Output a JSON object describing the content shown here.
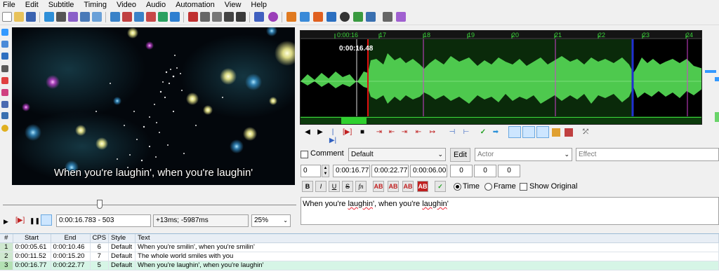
{
  "menu": [
    "File",
    "Edit",
    "Subtitle",
    "Timing",
    "Video",
    "Audio",
    "Automation",
    "View",
    "Help"
  ],
  "video": {
    "subtitle": "When you're laughin', when you're laughin'",
    "time_display": "0:00:16.783 - 503",
    "offset_display": "+13ms; -5987ms",
    "zoom": "25%"
  },
  "audio": {
    "cursor_time": "0:00:16.48",
    "ruler": [
      "0:00:16",
      "17",
      "18",
      "19",
      "20",
      "21",
      "22",
      "23",
      "24"
    ]
  },
  "edit": {
    "comment_label": "Comment",
    "style": "Default",
    "edit_button": "Edit",
    "actor_placeholder": "Actor",
    "effect_placeholder": "Effect",
    "layer": "0",
    "start": "0:00:16.77",
    "end": "0:00:22.77",
    "duration": "0:00:06.00",
    "margin_l": "0",
    "margin_r": "0",
    "margin_v": "0",
    "time_label": "Time",
    "frame_label": "Frame",
    "show_original_label": "Show Original",
    "text_parts": [
      "When you're ",
      "laughin",
      "', when you're ",
      "laughin",
      "'"
    ]
  },
  "grid": {
    "headers": [
      "#",
      "Start",
      "End",
      "CPS",
      "Style",
      "Text"
    ],
    "rows": [
      {
        "n": "1",
        "start": "0:00:05.61",
        "end": "0:00:10.46",
        "cps": "6",
        "style": "Default",
        "text": "When you're smilin', when you're smilin'"
      },
      {
        "n": "2",
        "start": "0:00:11.52",
        "end": "0:00:15.20",
        "cps": "7",
        "style": "Default",
        "text": "The whole world smiles with you"
      },
      {
        "n": "3",
        "start": "0:00:16.77",
        "end": "0:00:22.77",
        "cps": "5",
        "style": "Default",
        "text": "When you're laughin', when you're laughin'"
      }
    ]
  },
  "colors": {
    "accent": "#3399ff",
    "wave": "#4ec94e",
    "wave_selected": "#0a2a0a",
    "marker_red": "#e01010",
    "marker_pink": "#d040d0"
  }
}
